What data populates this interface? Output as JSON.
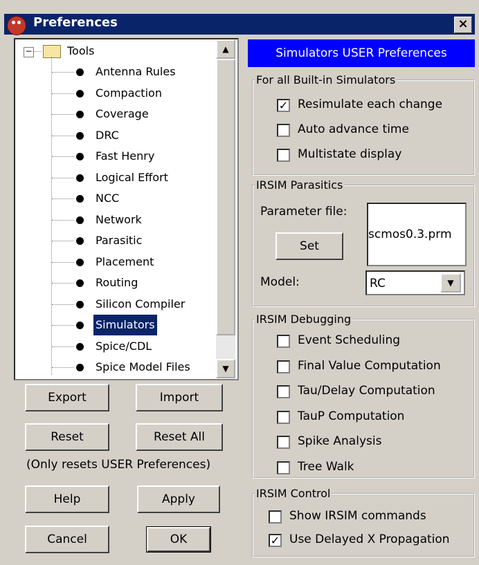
{
  "window": {
    "title": "Preferences",
    "close_glyph": "×",
    "app_icon": "app-logo-icon"
  },
  "tree": {
    "root": "Tools",
    "root_toggle": "−",
    "items": [
      "Antenna Rules",
      "Compaction",
      "Coverage",
      "DRC",
      "Fast Henry",
      "Logical Effort",
      "NCC",
      "Network",
      "Parasitic",
      "Placement",
      "Routing",
      "Silicon Compiler",
      "Simulators",
      "Spice/CDL",
      "Spice Model Files"
    ],
    "selected": "Simulators"
  },
  "buttons": {
    "export": "Export",
    "import": "Import",
    "reset": "Reset",
    "reset_all": "Reset All",
    "reset_note": "(Only resets USER Preferences)",
    "help": "Help",
    "apply": "Apply",
    "cancel": "Cancel",
    "ok": "OK"
  },
  "panel": {
    "header": "Simulators USER Preferences",
    "builtin": {
      "legend": "For all Built-in Simulators",
      "options": [
        {
          "label": "Resimulate each change",
          "checked": true
        },
        {
          "label": "Auto advance time",
          "checked": false
        },
        {
          "label": "Multistate display",
          "checked": false
        }
      ]
    },
    "parasitics": {
      "legend": "IRSIM Parasitics",
      "param_label": "Parameter file:",
      "param_value": "scmos0.3.prm",
      "set_button": "Set",
      "model_label": "Model:",
      "model_value": "RC"
    },
    "debugging": {
      "legend": "IRSIM Debugging",
      "options": [
        {
          "label": "Event Scheduling",
          "checked": false
        },
        {
          "label": "Final Value Computation",
          "checked": false
        },
        {
          "label": "Tau/Delay Computation",
          "checked": false
        },
        {
          "label": "TauP Computation",
          "checked": false
        },
        {
          "label": "Spike Analysis",
          "checked": false
        },
        {
          "label": "Tree Walk",
          "checked": false
        }
      ]
    },
    "control": {
      "legend": "IRSIM Control",
      "options": [
        {
          "label": "Show IRSIM commands",
          "checked": false
        },
        {
          "label": "Use Delayed X Propagation",
          "checked": true
        }
      ]
    }
  },
  "colors": {
    "titlebar": "#0a246a",
    "header": "#0000ff",
    "face": "#d4d0c8"
  }
}
